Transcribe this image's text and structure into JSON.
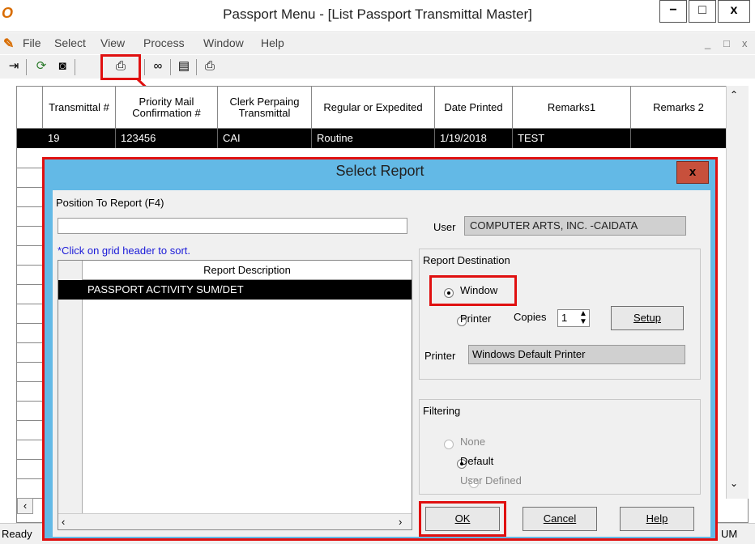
{
  "window": {
    "title": "Passport Menu - [List Passport Transmittal Master]",
    "minimize": "−",
    "maximize": "□",
    "close": "x",
    "mdi_controls": [
      "_",
      "□",
      "x"
    ]
  },
  "menu": [
    "File",
    "Select",
    "View",
    "Process",
    "Window",
    "Help"
  ],
  "grid": {
    "headers": [
      "Transmittal #",
      "Priority Mail Confirmation #",
      "Clerk Perpaing Transmittal",
      "Regular or Expedited",
      "Date Printed",
      "Remarks1",
      "Remarks 2"
    ],
    "rows": [
      [
        "19",
        "123456",
        "CAI",
        "Routine",
        "1/19/2018",
        "TEST",
        ""
      ]
    ]
  },
  "status": {
    "left": "Ready",
    "right": "UM"
  },
  "dialog": {
    "title": "Select Report",
    "close": "x",
    "position_label": "Position To Report (F4)",
    "position_value": "",
    "sort_hint": "*Click on grid header to sort.",
    "report_header": "Report Description",
    "reports": [
      "PASSPORT ACTIVITY SUM/DET"
    ],
    "user_label": "User",
    "user_value": "COMPUTER ARTS, INC. -CAIDATA",
    "destination": {
      "group_label": "Report Destination",
      "window_label": "Window",
      "printer_label": "Printer",
      "copies_label": "Copies",
      "copies_value": "1",
      "setup_label": "Setup",
      "printer_field_label": "Printer",
      "printer_value": "Windows Default Printer",
      "selected": "Window"
    },
    "filtering": {
      "group_label": "Filtering",
      "options": [
        "None",
        "Default",
        "User Defined"
      ],
      "selected": "Default"
    },
    "buttons": {
      "ok": "OK",
      "cancel": "Cancel",
      "help": "Help"
    }
  },
  "colors": {
    "highlight": "#e01010",
    "dialog_frame": "#63b9e6",
    "selection": "#000000"
  }
}
